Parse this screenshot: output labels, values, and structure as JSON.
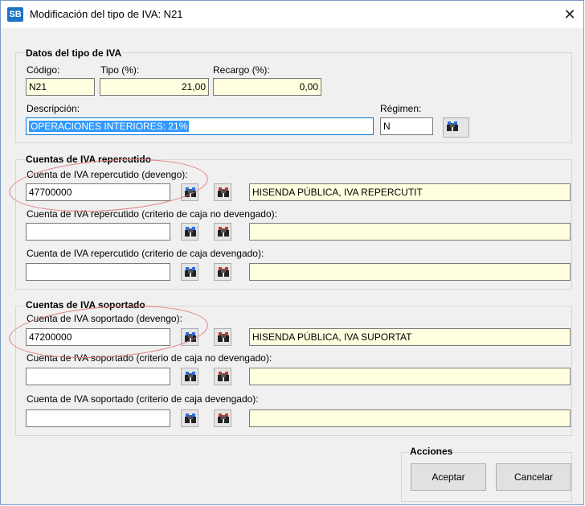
{
  "window": {
    "title": "Modificación del tipo de IVA: N21",
    "app_badge": "SB",
    "close_glyph": "✕"
  },
  "datos": {
    "group_title": "Datos del tipo de IVA",
    "codigo": {
      "label": "Código:",
      "value": "N21"
    },
    "tipo": {
      "label": "Tipo (%):",
      "value": "21,00"
    },
    "recargo": {
      "label": "Recargo (%):",
      "value": "0,00"
    },
    "descripcion": {
      "label": "Descripción:",
      "value": "OPERACIONES INTERIORES: 21%"
    },
    "regimen": {
      "label": "Régimen:",
      "value": "N"
    }
  },
  "repercutido": {
    "group_title": "Cuentas de IVA repercutido",
    "rows": [
      {
        "label": "Cuenta de IVA repercutido (devengo):",
        "value": "47700000",
        "description": "HISENDA PÚBLICA, IVA REPERCUTIT"
      },
      {
        "label": "Cuenta de IVA repercutido (criterio de caja no devengado):",
        "value": "",
        "description": ""
      },
      {
        "label": "Cuenta de IVA repercutido (criterio de caja devengado):",
        "value": "",
        "description": ""
      }
    ]
  },
  "soportado": {
    "group_title": "Cuentas de IVA soportado",
    "rows": [
      {
        "label": "Cuenta de IVA soportado (devengo):",
        "value": "47200000",
        "description": "HISENDA PÚBLICA, IVA SUPORTAT"
      },
      {
        "label": "Cuenta de IVA soportado (criterio de caja no devengado):",
        "value": "",
        "description": ""
      },
      {
        "label": "Cuenta de IVA soportado (criterio de caja devengado):",
        "value": "",
        "description": ""
      }
    ]
  },
  "acciones": {
    "group_title": "Acciones",
    "aceptar": "Aceptar",
    "cancelar": "Cancelar"
  },
  "icons": {
    "search": "binoculars-icon",
    "edit": "binoculars-edit-icon"
  },
  "colors": {
    "highlight": "#3399ff",
    "yellow_field": "#ffffe0",
    "annotation": "#e17c7c"
  }
}
